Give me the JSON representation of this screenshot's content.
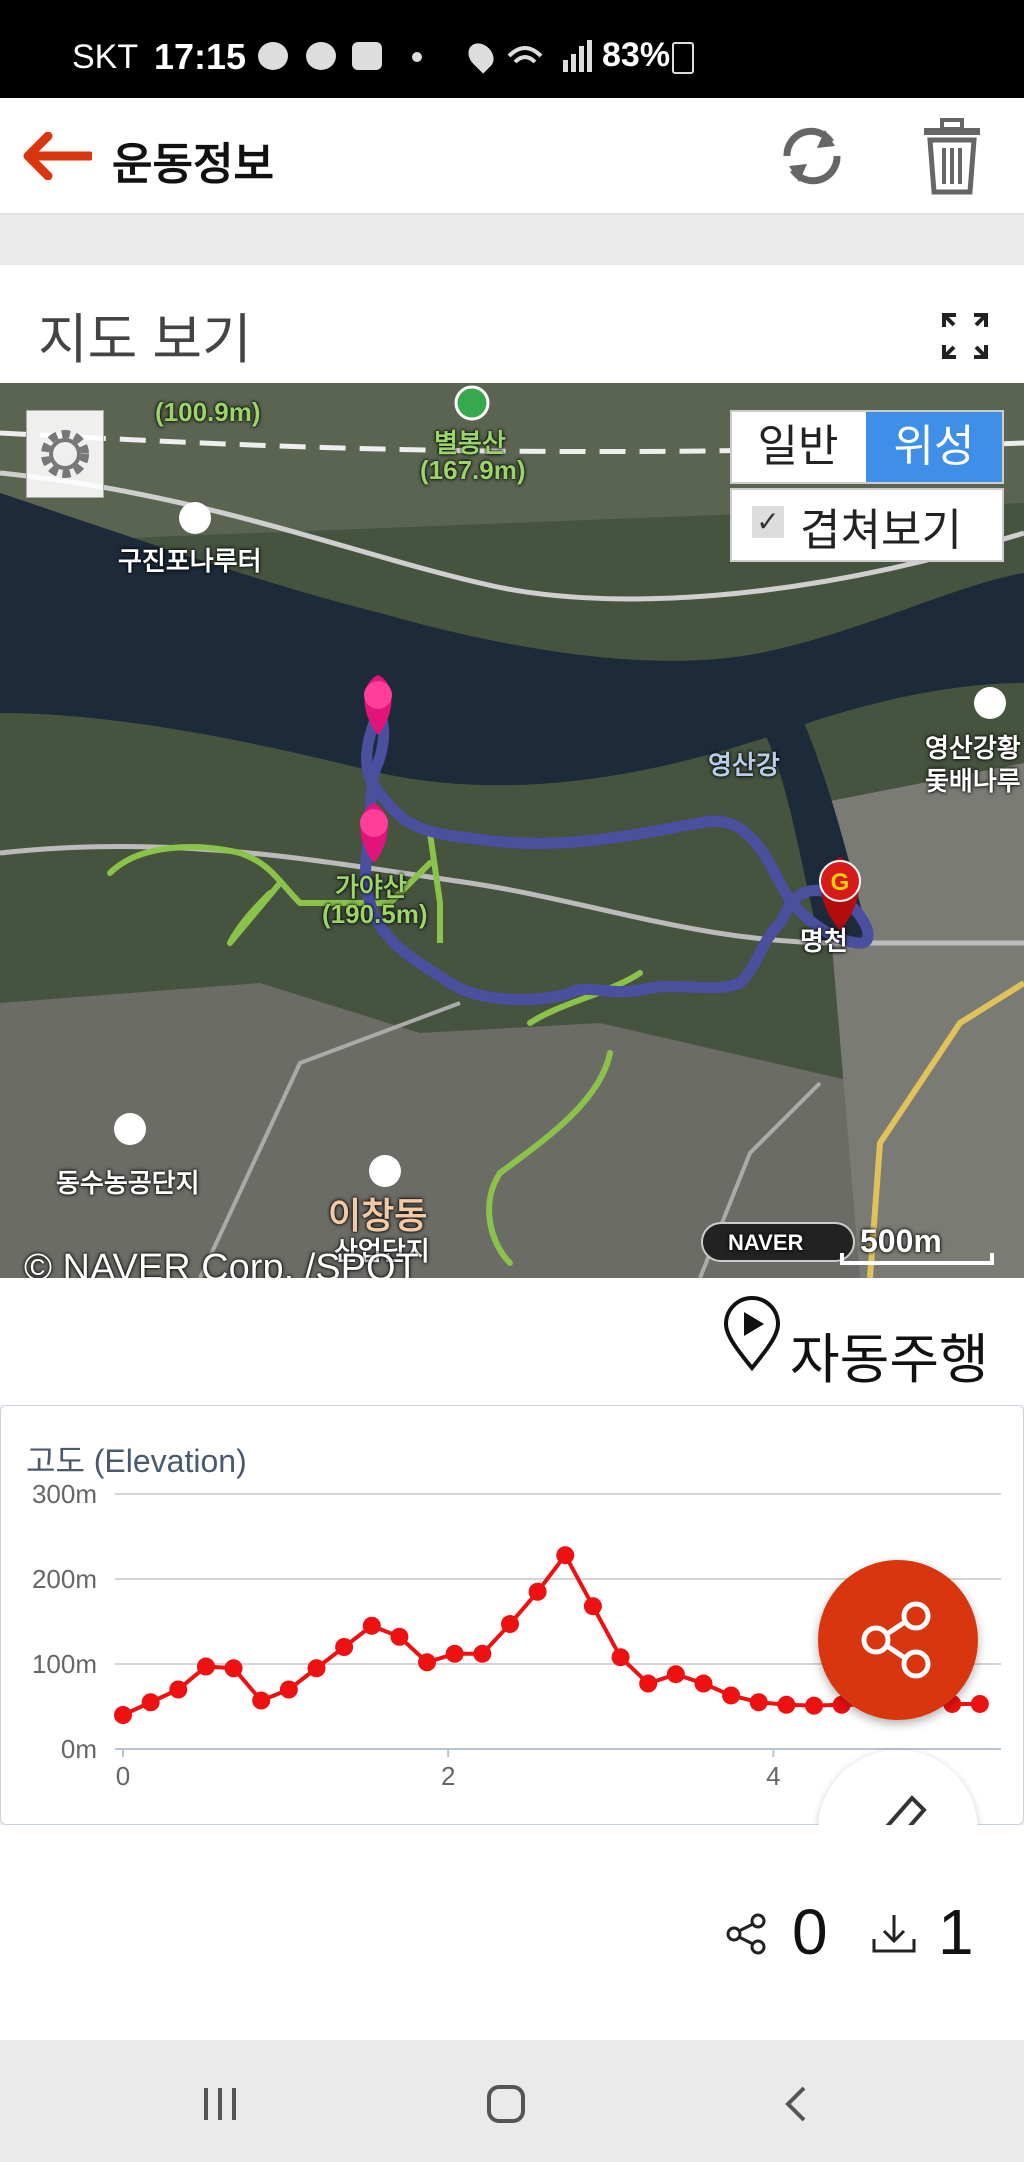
{
  "status_bar": {
    "carrier": "SKT",
    "time": "17:15",
    "battery": "83%"
  },
  "app_bar": {
    "title": "운동정보",
    "icons": [
      "back-arrow-icon",
      "refresh-icon",
      "trash-icon"
    ]
  },
  "map_section": {
    "title": "지도 보기",
    "map_type": {
      "normal": "일반",
      "satellite": "위성",
      "selected": "위성"
    },
    "overlay": {
      "label": "겹쳐보기",
      "checked": true
    },
    "scale": "500m",
    "provider_logo": "NAVER",
    "copyright": "© NAVER Corp. /SPOT",
    "labels": {
      "l1": "(100.9m)",
      "l2": "별봉산",
      "l3": "(167.9m)",
      "l4": "구진포나루터",
      "l5": "영산강",
      "l6": "영산강황",
      "l7": "돛배나루",
      "l8": "가야산",
      "l9": "(190.5m)",
      "l10": "동수농공단지",
      "l11": "이창동",
      "l12": "산업단지",
      "l13": "명천"
    }
  },
  "auto_drive": {
    "label": "자동주행"
  },
  "chart_data": {
    "type": "line",
    "title": "고도 (Elevation)",
    "xlabel": "",
    "ylabel": "",
    "x_ticks": [
      "0",
      "2",
      "4"
    ],
    "y_ticks": [
      "0m",
      "100m",
      "200m",
      "300m"
    ],
    "xlim": [
      0,
      5.4
    ],
    "ylim": [
      0,
      300
    ],
    "grid": true,
    "color": "#ee1111",
    "x": [
      0,
      0.17,
      0.34,
      0.51,
      0.68,
      0.85,
      1.02,
      1.19,
      1.36,
      1.53,
      1.7,
      1.87,
      2.04,
      2.21,
      2.38,
      2.55,
      2.72,
      2.89,
      3.06,
      3.23,
      3.4,
      3.57,
      3.74,
      3.91,
      4.08,
      4.25,
      4.42,
      4.59,
      4.76,
      4.93,
      5.1,
      5.27
    ],
    "y": [
      40,
      55,
      70,
      97,
      95,
      57,
      70,
      95,
      120,
      145,
      132,
      102,
      112,
      112,
      147,
      185,
      228,
      168,
      108,
      77,
      88,
      77,
      63,
      55,
      52,
      51,
      52,
      52,
      53,
      53,
      53,
      53
    ]
  },
  "counters": {
    "shares": "0",
    "downloads": "1"
  },
  "colors": {
    "accent": "#d9360f",
    "toggle_active": "#3f8fe8",
    "route": "#4a4f9e",
    "trail": "#8bc34a"
  }
}
